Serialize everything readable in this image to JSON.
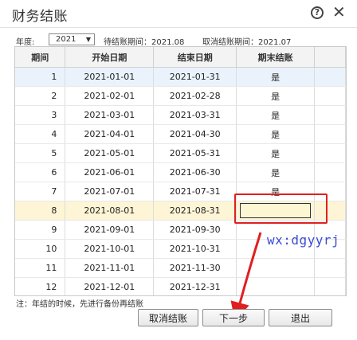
{
  "window": {
    "title": "财务结账",
    "help_glyph": "?",
    "close_glyph": "✕"
  },
  "yearbar": {
    "year_label": "年度:",
    "year_value": "2021",
    "pending_text": "待结账期间：2021.08",
    "cancelable_text": "取消结账期间：2021.07"
  },
  "grid": {
    "columns": [
      "期间",
      "开始日期",
      "结束日期",
      "期末结账"
    ],
    "rows": [
      {
        "period": "1",
        "start": "2021-01-01",
        "end": "2021-01-31",
        "closed": "是"
      },
      {
        "period": "2",
        "start": "2021-02-01",
        "end": "2021-02-28",
        "closed": "是"
      },
      {
        "period": "3",
        "start": "2021-03-01",
        "end": "2021-03-31",
        "closed": "是"
      },
      {
        "period": "4",
        "start": "2021-04-01",
        "end": "2021-04-30",
        "closed": "是"
      },
      {
        "period": "5",
        "start": "2021-05-01",
        "end": "2021-05-31",
        "closed": "是"
      },
      {
        "period": "6",
        "start": "2021-06-01",
        "end": "2021-06-30",
        "closed": "是"
      },
      {
        "period": "7",
        "start": "2021-07-01",
        "end": "2021-07-31",
        "closed": "是"
      },
      {
        "period": "8",
        "start": "2021-08-01",
        "end": "2021-08-31",
        "closed": ""
      },
      {
        "period": "9",
        "start": "2021-09-01",
        "end": "2021-09-30",
        "closed": ""
      },
      {
        "period": "10",
        "start": "2021-10-01",
        "end": "2021-10-31",
        "closed": ""
      },
      {
        "period": "11",
        "start": "2021-11-01",
        "end": "2021-11-30",
        "closed": ""
      },
      {
        "period": "12",
        "start": "2021-12-01",
        "end": "2021-12-31",
        "closed": ""
      }
    ],
    "selected_row_index": 0,
    "current_row_index": 7
  },
  "note": "注：年结的时候，先进行备份再结账",
  "buttons": {
    "cancel": "取消结账",
    "next": "下一步",
    "exit": "退出"
  },
  "annotation": {
    "watermark": "wx:dgyyrj",
    "highlight_color": "#e02020"
  }
}
